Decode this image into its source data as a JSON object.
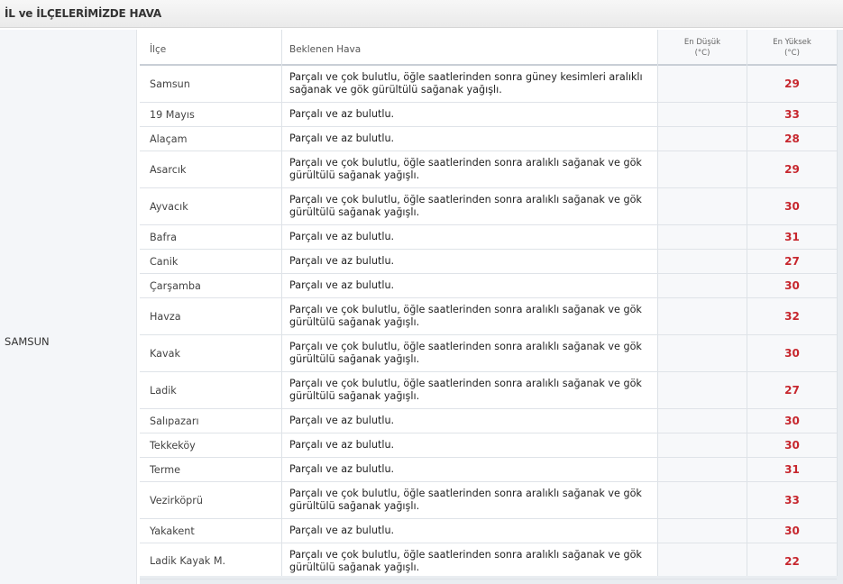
{
  "header": {
    "title": "İL ve İLÇELERİMİZDE HAVA"
  },
  "province": {
    "name": "SAMSUN"
  },
  "table": {
    "columns": {
      "ilce": "İlçe",
      "hava": "Beklenen Hava",
      "min_line1": "En Düşük",
      "min_line2": "(°C)",
      "max_line1": "En Yüksek",
      "max_line2": "(°C)"
    },
    "rows": [
      {
        "ilce": "Samsun",
        "hava": "Parçalı ve çok bulutlu, öğle saatlerinden sonra güney kesimleri aralıklı sağanak ve gök gürültülü sağanak yağışlı.",
        "min": "",
        "max": "29"
      },
      {
        "ilce": "19 Mayıs",
        "hava": "Parçalı ve az bulutlu.",
        "min": "",
        "max": "33"
      },
      {
        "ilce": "Alaçam",
        "hava": "Parçalı ve az bulutlu.",
        "min": "",
        "max": "28"
      },
      {
        "ilce": "Asarcık",
        "hava": "Parçalı ve çok bulutlu, öğle saatlerinden sonra aralıklı sağanak ve gök gürültülü sağanak yağışlı.",
        "min": "",
        "max": "29"
      },
      {
        "ilce": "Ayvacık",
        "hava": "Parçalı ve çok bulutlu, öğle saatlerinden sonra aralıklı sağanak ve gök gürültülü sağanak yağışlı.",
        "min": "",
        "max": "30"
      },
      {
        "ilce": "Bafra",
        "hava": "Parçalı ve az bulutlu.",
        "min": "",
        "max": "31"
      },
      {
        "ilce": "Canik",
        "hava": "Parçalı ve az bulutlu.",
        "min": "",
        "max": "27"
      },
      {
        "ilce": "Çarşamba",
        "hava": "Parçalı ve az bulutlu.",
        "min": "",
        "max": "30"
      },
      {
        "ilce": "Havza",
        "hava": "Parçalı ve çok bulutlu, öğle saatlerinden sonra aralıklı sağanak ve gök gürültülü sağanak yağışlı.",
        "min": "",
        "max": "32"
      },
      {
        "ilce": "Kavak",
        "hava": "Parçalı ve çok bulutlu, öğle saatlerinden sonra aralıklı sağanak ve gök gürültülü sağanak yağışlı.",
        "min": "",
        "max": "30"
      },
      {
        "ilce": "Ladik",
        "hava": "Parçalı ve çok bulutlu, öğle saatlerinden sonra aralıklı sağanak ve gök gürültülü sağanak yağışlı.",
        "min": "",
        "max": "27"
      },
      {
        "ilce": "Salıpazarı",
        "hava": "Parçalı ve az bulutlu.",
        "min": "",
        "max": "30"
      },
      {
        "ilce": "Tekkeköy",
        "hava": "Parçalı ve az bulutlu.",
        "min": "",
        "max": "30"
      },
      {
        "ilce": "Terme",
        "hava": "Parçalı ve az bulutlu.",
        "min": "",
        "max": "31"
      },
      {
        "ilce": "Vezirköprü",
        "hava": "Parçalı ve çok bulutlu, öğle saatlerinden sonra aralıklı sağanak ve gök gürültülü sağanak yağışlı.",
        "min": "",
        "max": "33"
      },
      {
        "ilce": "Yakakent",
        "hava": "Parçalı ve az bulutlu.",
        "min": "",
        "max": "30"
      },
      {
        "ilce": "Ladik Kayak M.",
        "hava": "Parçalı ve çok bulutlu, öğle saatlerinden sonra aralıklı sağanak ve gök gürültülü sağanak yağışlı.",
        "min": "",
        "max": "22"
      }
    ]
  },
  "colors": {
    "max_temp": "#c7272e",
    "header_bg": "#eaeaea",
    "table_bg": "#e9edf1"
  }
}
